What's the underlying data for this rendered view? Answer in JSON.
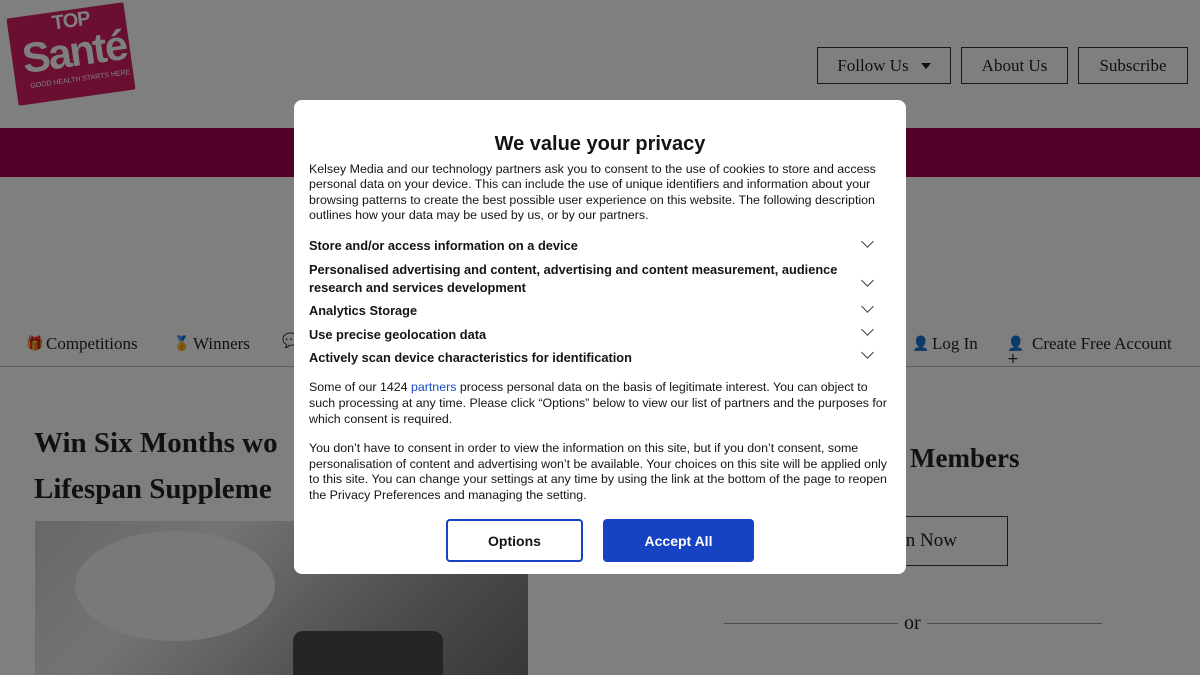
{
  "site": {
    "logo_top": "TOP",
    "logo_main": "Santé",
    "logo_tagline": "GOOD HEALTH STARTS HERE"
  },
  "header": {
    "follow_label": "Follow Us",
    "about_label": "About Us",
    "subscribe_label": "Subscribe"
  },
  "nav": {
    "competitions": "Competitions",
    "winners": "Winners",
    "login": "Log In",
    "create_account": "Create Free Account"
  },
  "article": {
    "title_line1": "Win Six Months wo",
    "title_line2": "Lifespan Suppleme"
  },
  "sidebar": {
    "members_heading": "Members",
    "join_label": "n Now",
    "or_text": "or"
  },
  "consent": {
    "title": "We value your privacy",
    "intro": "Kelsey Media and our technology partners ask you to consent to the use of cookies to store and access personal data on your device. This can include the use of unique identifiers and information about your browsing patterns to create the best possible user experience on this website. The following description outlines how your data may be used by us, or by our partners.",
    "purposes": [
      "Store and/or access information on a device",
      "Personalised advertising and content, advertising and content measurement, audience research and services development",
      "Analytics Storage",
      "Use precise geolocation data",
      "Actively scan device characteristics for identification"
    ],
    "legit_prefix": "Some of our 1424 ",
    "legit_link": "partners",
    "legit_suffix": " process personal data on the basis of legitimate interest. You can object to such processing at any time. Please click “Options” below to view our list of partners and the purposes for which consent is required.",
    "no_consent": "You don’t have to consent in order to view the information on this site, but if you don’t consent, some personalisation of content and advertising won’t be available. Your choices on this site will be applied only to this site. You can change your settings at any time by using the link at the bottom of the page to reopen the Privacy Preferences and managing the setting.",
    "options_label": "Options",
    "accept_label": "Accept All"
  },
  "colors": {
    "brand_pink": "#d41e63",
    "brand_bar": "#a40051",
    "accept_blue": "#1543c4"
  }
}
